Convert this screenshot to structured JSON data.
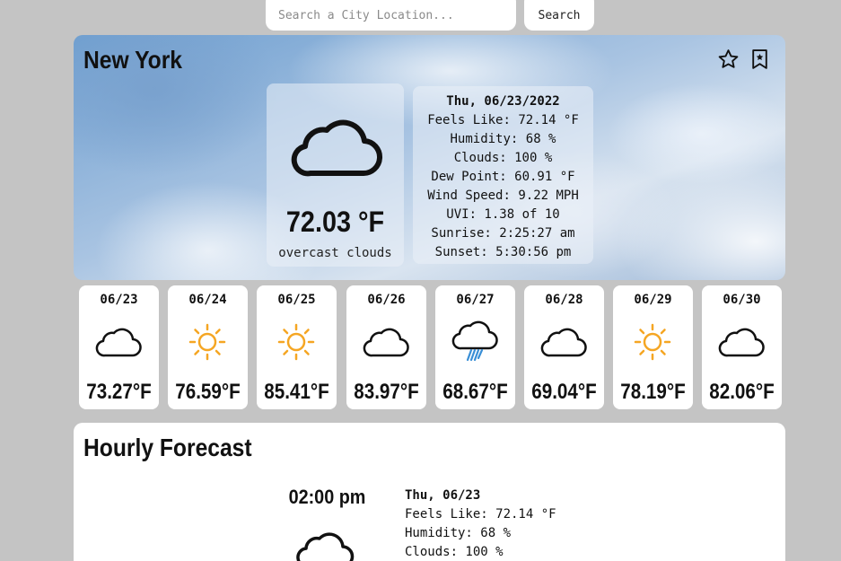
{
  "search": {
    "placeholder": "Search a City Location...",
    "button_label": "Search"
  },
  "current": {
    "city": "New York",
    "icon": "cloud-icon",
    "temperature": "72.03 °F",
    "description": "overcast clouds",
    "details": {
      "date": "Thu, 06/23/2022",
      "feels_like": "Feels Like: 72.14 °F",
      "humidity": "Humidity: 68 %",
      "clouds": "Clouds: 100 %",
      "dew_point": "Dew Point: 60.91 °F",
      "wind_speed": "Wind Speed: 9.22 MPH",
      "uvi": "UVI: 1.38 of 10",
      "sunrise": "Sunrise: 2:25:27 am",
      "sunset": "Sunset: 5:30:56 pm"
    },
    "actions": [
      "star-icon",
      "bookmark-icon"
    ]
  },
  "daily": [
    {
      "date": "06/23",
      "icon": "cloud-icon",
      "temp": "73.27°F"
    },
    {
      "date": "06/24",
      "icon": "sun-icon",
      "temp": "76.59°F"
    },
    {
      "date": "06/25",
      "icon": "sun-icon",
      "temp": "85.41°F"
    },
    {
      "date": "06/26",
      "icon": "cloud-icon",
      "temp": "83.97°F"
    },
    {
      "date": "06/27",
      "icon": "rain-cloud-icon",
      "temp": "68.67°F"
    },
    {
      "date": "06/28",
      "icon": "cloud-icon",
      "temp": "69.04°F"
    },
    {
      "date": "06/29",
      "icon": "sun-icon",
      "temp": "78.19°F"
    },
    {
      "date": "06/30",
      "icon": "cloud-icon",
      "temp": "82.06°F"
    }
  ],
  "hourly": {
    "title": "Hourly Forecast",
    "items": [
      {
        "time": "02:00 pm",
        "icon": "cloud-icon",
        "date": "Thu, 06/23",
        "feels_like": "Feels Like: 72.14 °F",
        "humidity": "Humidity: 68 %",
        "clouds": "Clouds: 100 %"
      }
    ]
  },
  "colors": {
    "sun": "#f5a623",
    "rain": "#3a8fd6",
    "background": "#c4c4c4",
    "card": "#ffffff"
  }
}
